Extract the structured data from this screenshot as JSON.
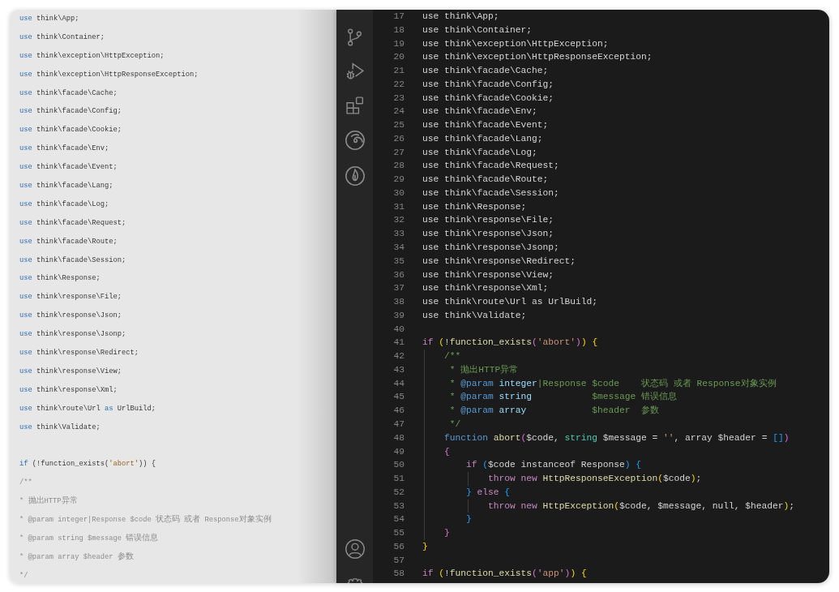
{
  "document_page": {
    "blocks": [
      {
        "lines": [
          {
            "spans": [
              {
                "kind": "keyword",
                "text": "use"
              },
              {
                "kind": "plain",
                "text": " think\\App;"
              }
            ]
          },
          {
            "spans": [
              {
                "kind": "keyword",
                "text": "use"
              },
              {
                "kind": "plain",
                "text": " think\\Container;"
              }
            ]
          },
          {
            "spans": [
              {
                "kind": "keyword",
                "text": "use"
              },
              {
                "kind": "plain",
                "text": " think\\exception\\HttpException;"
              }
            ]
          },
          {
            "spans": [
              {
                "kind": "keyword",
                "text": "use"
              },
              {
                "kind": "plain",
                "text": " think\\exception\\HttpResponseException;"
              }
            ]
          },
          {
            "spans": [
              {
                "kind": "keyword",
                "text": "use"
              },
              {
                "kind": "plain",
                "text": " think\\facade\\Cache;"
              }
            ]
          },
          {
            "spans": [
              {
                "kind": "keyword",
                "text": "use"
              },
              {
                "kind": "plain",
                "text": " think\\facade\\Config;"
              }
            ]
          },
          {
            "spans": [
              {
                "kind": "keyword",
                "text": "use"
              },
              {
                "kind": "plain",
                "text": " think\\facade\\Cookie;"
              }
            ]
          },
          {
            "spans": [
              {
                "kind": "keyword",
                "text": "use"
              },
              {
                "kind": "plain",
                "text": " think\\facade\\Env;"
              }
            ]
          },
          {
            "spans": [
              {
                "kind": "keyword",
                "text": "use"
              },
              {
                "kind": "plain",
                "text": " think\\facade\\Event;"
              }
            ]
          },
          {
            "spans": [
              {
                "kind": "keyword",
                "text": "use"
              },
              {
                "kind": "plain",
                "text": " think\\facade\\Lang;"
              }
            ]
          },
          {
            "spans": [
              {
                "kind": "keyword",
                "text": "use"
              },
              {
                "kind": "plain",
                "text": " think\\facade\\Log;"
              }
            ]
          },
          {
            "spans": [
              {
                "kind": "keyword",
                "text": "use"
              },
              {
                "kind": "plain",
                "text": " think\\facade\\Request;"
              }
            ]
          },
          {
            "spans": [
              {
                "kind": "keyword",
                "text": "use"
              },
              {
                "kind": "plain",
                "text": " think\\facade\\Route;"
              }
            ]
          },
          {
            "spans": [
              {
                "kind": "keyword",
                "text": "use"
              },
              {
                "kind": "plain",
                "text": " think\\facade\\Session;"
              }
            ]
          },
          {
            "spans": [
              {
                "kind": "keyword",
                "text": "use"
              },
              {
                "kind": "plain",
                "text": " think\\Response;"
              }
            ]
          },
          {
            "spans": [
              {
                "kind": "keyword",
                "text": "use"
              },
              {
                "kind": "plain",
                "text": " think\\response\\File;"
              }
            ]
          },
          {
            "spans": [
              {
                "kind": "keyword",
                "text": "use"
              },
              {
                "kind": "plain",
                "text": " think\\response\\Json;"
              }
            ]
          },
          {
            "spans": [
              {
                "kind": "keyword",
                "text": "use"
              },
              {
                "kind": "plain",
                "text": " think\\response\\Jsonp;"
              }
            ]
          },
          {
            "spans": [
              {
                "kind": "keyword",
                "text": "use"
              },
              {
                "kind": "plain",
                "text": " think\\response\\Redirect;"
              }
            ]
          },
          {
            "spans": [
              {
                "kind": "keyword",
                "text": "use"
              },
              {
                "kind": "plain",
                "text": " think\\response\\View;"
              }
            ]
          },
          {
            "spans": [
              {
                "kind": "keyword",
                "text": "use"
              },
              {
                "kind": "plain",
                "text": " think\\response\\Xml;"
              }
            ]
          },
          {
            "spans": [
              {
                "kind": "keyword",
                "text": "use"
              },
              {
                "kind": "plain",
                "text": " think\\route\\Url "
              },
              {
                "kind": "keyword",
                "text": "as"
              },
              {
                "kind": "plain",
                "text": " UrlBuild;"
              }
            ]
          },
          {
            "spans": [
              {
                "kind": "keyword",
                "text": "use"
              },
              {
                "kind": "plain",
                "text": " think\\Validate;"
              }
            ]
          }
        ]
      },
      {
        "lines": [
          {
            "spans": [
              {
                "kind": "keyword",
                "text": "if"
              },
              {
                "kind": "plain",
                "text": " (!function_exists("
              },
              {
                "kind": "string",
                "text": "'abort'"
              },
              {
                "kind": "plain",
                "text": ")) {"
              }
            ]
          },
          {
            "spans": [
              {
                "kind": "comment",
                "text": "/**"
              }
            ]
          },
          {
            "spans": [
              {
                "kind": "comment",
                "text": "* 抛出HTTP异常"
              }
            ]
          },
          {
            "spans": [
              {
                "kind": "comment",
                "text": "* @param integer|Response $code 状态码 或者 Response对象实例"
              }
            ]
          },
          {
            "spans": [
              {
                "kind": "comment",
                "text": "* @param string $message 错误信息"
              }
            ]
          },
          {
            "spans": [
              {
                "kind": "comment",
                "text": "* @param array $header 参数"
              }
            ]
          },
          {
            "spans": [
              {
                "kind": "comment",
                "text": "*/"
              }
            ]
          }
        ]
      }
    ]
  },
  "editor": {
    "lines": [
      {
        "number": "17",
        "spans": [
          {
            "kind": "plain",
            "text": "use think\\App;"
          }
        ]
      },
      {
        "number": "18",
        "spans": [
          {
            "kind": "plain",
            "text": "use think\\Container;"
          }
        ]
      },
      {
        "number": "19",
        "spans": [
          {
            "kind": "plain",
            "text": "use think\\exception\\HttpException;"
          }
        ]
      },
      {
        "number": "20",
        "spans": [
          {
            "kind": "plain",
            "text": "use think\\exception\\HttpResponseException;"
          }
        ]
      },
      {
        "number": "21",
        "spans": [
          {
            "kind": "plain",
            "text": "use think\\facade\\Cache;"
          }
        ]
      },
      {
        "number": "22",
        "spans": [
          {
            "kind": "plain",
            "text": "use think\\facade\\Config;"
          }
        ]
      },
      {
        "number": "23",
        "spans": [
          {
            "kind": "plain",
            "text": "use think\\facade\\Cookie;"
          }
        ]
      },
      {
        "number": "24",
        "spans": [
          {
            "kind": "plain",
            "text": "use think\\facade\\Env;"
          }
        ]
      },
      {
        "number": "25",
        "spans": [
          {
            "kind": "plain",
            "text": "use think\\facade\\Event;"
          }
        ]
      },
      {
        "number": "26",
        "spans": [
          {
            "kind": "plain",
            "text": "use think\\facade\\Lang;"
          }
        ]
      },
      {
        "number": "27",
        "spans": [
          {
            "kind": "plain",
            "text": "use think\\facade\\Log;"
          }
        ]
      },
      {
        "number": "28",
        "spans": [
          {
            "kind": "plain",
            "text": "use think\\facade\\Request;"
          }
        ]
      },
      {
        "number": "29",
        "spans": [
          {
            "kind": "plain",
            "text": "use think\\facade\\Route;"
          }
        ]
      },
      {
        "number": "30",
        "spans": [
          {
            "kind": "plain",
            "text": "use think\\facade\\Session;"
          }
        ]
      },
      {
        "number": "31",
        "spans": [
          {
            "kind": "plain",
            "text": "use think\\Response;"
          }
        ]
      },
      {
        "number": "32",
        "spans": [
          {
            "kind": "plain",
            "text": "use think\\response\\File;"
          }
        ]
      },
      {
        "number": "33",
        "spans": [
          {
            "kind": "plain",
            "text": "use think\\response\\Json;"
          }
        ]
      },
      {
        "number": "34",
        "spans": [
          {
            "kind": "plain",
            "text": "use think\\response\\Jsonp;"
          }
        ]
      },
      {
        "number": "35",
        "spans": [
          {
            "kind": "plain",
            "text": "use think\\response\\Redirect;"
          }
        ]
      },
      {
        "number": "36",
        "spans": [
          {
            "kind": "plain",
            "text": "use think\\response\\View;"
          }
        ]
      },
      {
        "number": "37",
        "spans": [
          {
            "kind": "plain",
            "text": "use think\\response\\Xml;"
          }
        ]
      },
      {
        "number": "38",
        "spans": [
          {
            "kind": "plain",
            "text": "use think\\route\\Url as UrlBuild;"
          }
        ]
      },
      {
        "number": "39",
        "spans": [
          {
            "kind": "plain",
            "text": "use think\\Validate;"
          }
        ]
      },
      {
        "number": "40"
      },
      {
        "number": "41",
        "spans": [
          {
            "kind": "keyword",
            "text": "if "
          },
          {
            "kind": "bracket1",
            "text": "("
          },
          {
            "kind": "plain",
            "text": "!"
          },
          {
            "kind": "function",
            "text": "function_exists"
          },
          {
            "kind": "bracket2",
            "text": "("
          },
          {
            "kind": "string",
            "text": "'abort'"
          },
          {
            "kind": "bracket2",
            "text": ")"
          },
          {
            "kind": "bracket1",
            "text": ") {"
          }
        ]
      },
      {
        "number": "42",
        "spans": [
          {
            "kind": "comment",
            "text": "    /**"
          }
        ]
      },
      {
        "number": "43",
        "spans": [
          {
            "kind": "comment",
            "text": "     * 抛出HTTP异常"
          }
        ]
      },
      {
        "number": "44",
        "spans": [
          {
            "kind": "comment",
            "text": "     * "
          },
          {
            "kind": "doctag",
            "text": "@param "
          },
          {
            "kind": "doctype",
            "text": "integer"
          },
          {
            "kind": "comment",
            "text": "|Response $code    状态码 或者 Response对象实例"
          }
        ]
      },
      {
        "number": "45",
        "spans": [
          {
            "kind": "comment",
            "text": "     * "
          },
          {
            "kind": "doctag",
            "text": "@param "
          },
          {
            "kind": "doctype",
            "text": "string"
          },
          {
            "kind": "comment",
            "text": "           $message 错误信息"
          }
        ]
      },
      {
        "number": "46",
        "spans": [
          {
            "kind": "comment",
            "text": "     * "
          },
          {
            "kind": "doctag",
            "text": "@param "
          },
          {
            "kind": "doctype",
            "text": "array"
          },
          {
            "kind": "comment",
            "text": "            $header  参数"
          }
        ]
      },
      {
        "number": "47",
        "spans": [
          {
            "kind": "comment",
            "text": "     */"
          }
        ]
      },
      {
        "number": "48",
        "spans": [
          {
            "kind": "storage",
            "text": "    function "
          },
          {
            "kind": "function",
            "text": "abort"
          },
          {
            "kind": "bracket2",
            "text": "("
          },
          {
            "kind": "plain",
            "text": "$code, "
          },
          {
            "kind": "type",
            "text": "string"
          },
          {
            "kind": "plain",
            "text": " $message = "
          },
          {
            "kind": "string",
            "text": "''"
          },
          {
            "kind": "plain",
            "text": ", array $header = "
          },
          {
            "kind": "bracket3",
            "text": "[]"
          },
          {
            "kind": "bracket2",
            "text": ")"
          }
        ]
      },
      {
        "number": "49",
        "spans": [
          {
            "kind": "bracket2",
            "text": "    {"
          }
        ]
      },
      {
        "number": "50",
        "spans": [
          {
            "kind": "keyword",
            "text": "        if "
          },
          {
            "kind": "bracket3",
            "text": "("
          },
          {
            "kind": "plain",
            "text": "$code instanceof Response"
          },
          {
            "kind": "bracket3",
            "text": ") {"
          }
        ]
      },
      {
        "number": "51",
        "spans": [
          {
            "kind": "keyword",
            "text": "            throw new "
          },
          {
            "kind": "function",
            "text": "HttpResponseException"
          },
          {
            "kind": "bracket1",
            "text": "("
          },
          {
            "kind": "plain",
            "text": "$code"
          },
          {
            "kind": "bracket1",
            "text": ")"
          },
          {
            "kind": "plain",
            "text": ";"
          }
        ]
      },
      {
        "number": "52",
        "spans": [
          {
            "kind": "bracket3",
            "text": "        } "
          },
          {
            "kind": "keyword",
            "text": "else "
          },
          {
            "kind": "bracket3",
            "text": "{"
          }
        ]
      },
      {
        "number": "53",
        "spans": [
          {
            "kind": "keyword",
            "text": "            throw new "
          },
          {
            "kind": "function",
            "text": "HttpException"
          },
          {
            "kind": "bracket1",
            "text": "("
          },
          {
            "kind": "plain",
            "text": "$code, $message, null, $header"
          },
          {
            "kind": "bracket1",
            "text": ")"
          },
          {
            "kind": "plain",
            "text": ";"
          }
        ]
      },
      {
        "number": "54",
        "spans": [
          {
            "kind": "bracket3",
            "text": "        }"
          }
        ]
      },
      {
        "number": "55",
        "spans": [
          {
            "kind": "bracket2",
            "text": "    }"
          }
        ]
      },
      {
        "number": "56",
        "spans": [
          {
            "kind": "bracket1",
            "text": "}"
          }
        ]
      },
      {
        "number": "57"
      },
      {
        "number": "58",
        "spans": [
          {
            "kind": "keyword",
            "text": "if "
          },
          {
            "kind": "bracket1",
            "text": "("
          },
          {
            "kind": "plain",
            "text": "!"
          },
          {
            "kind": "function",
            "text": "function_exists"
          },
          {
            "kind": "bracket2",
            "text": "("
          },
          {
            "kind": "string",
            "text": "'app'"
          },
          {
            "kind": "bracket2",
            "text": ")"
          },
          {
            "kind": "bracket1",
            "text": ") {"
          }
        ]
      }
    ]
  }
}
